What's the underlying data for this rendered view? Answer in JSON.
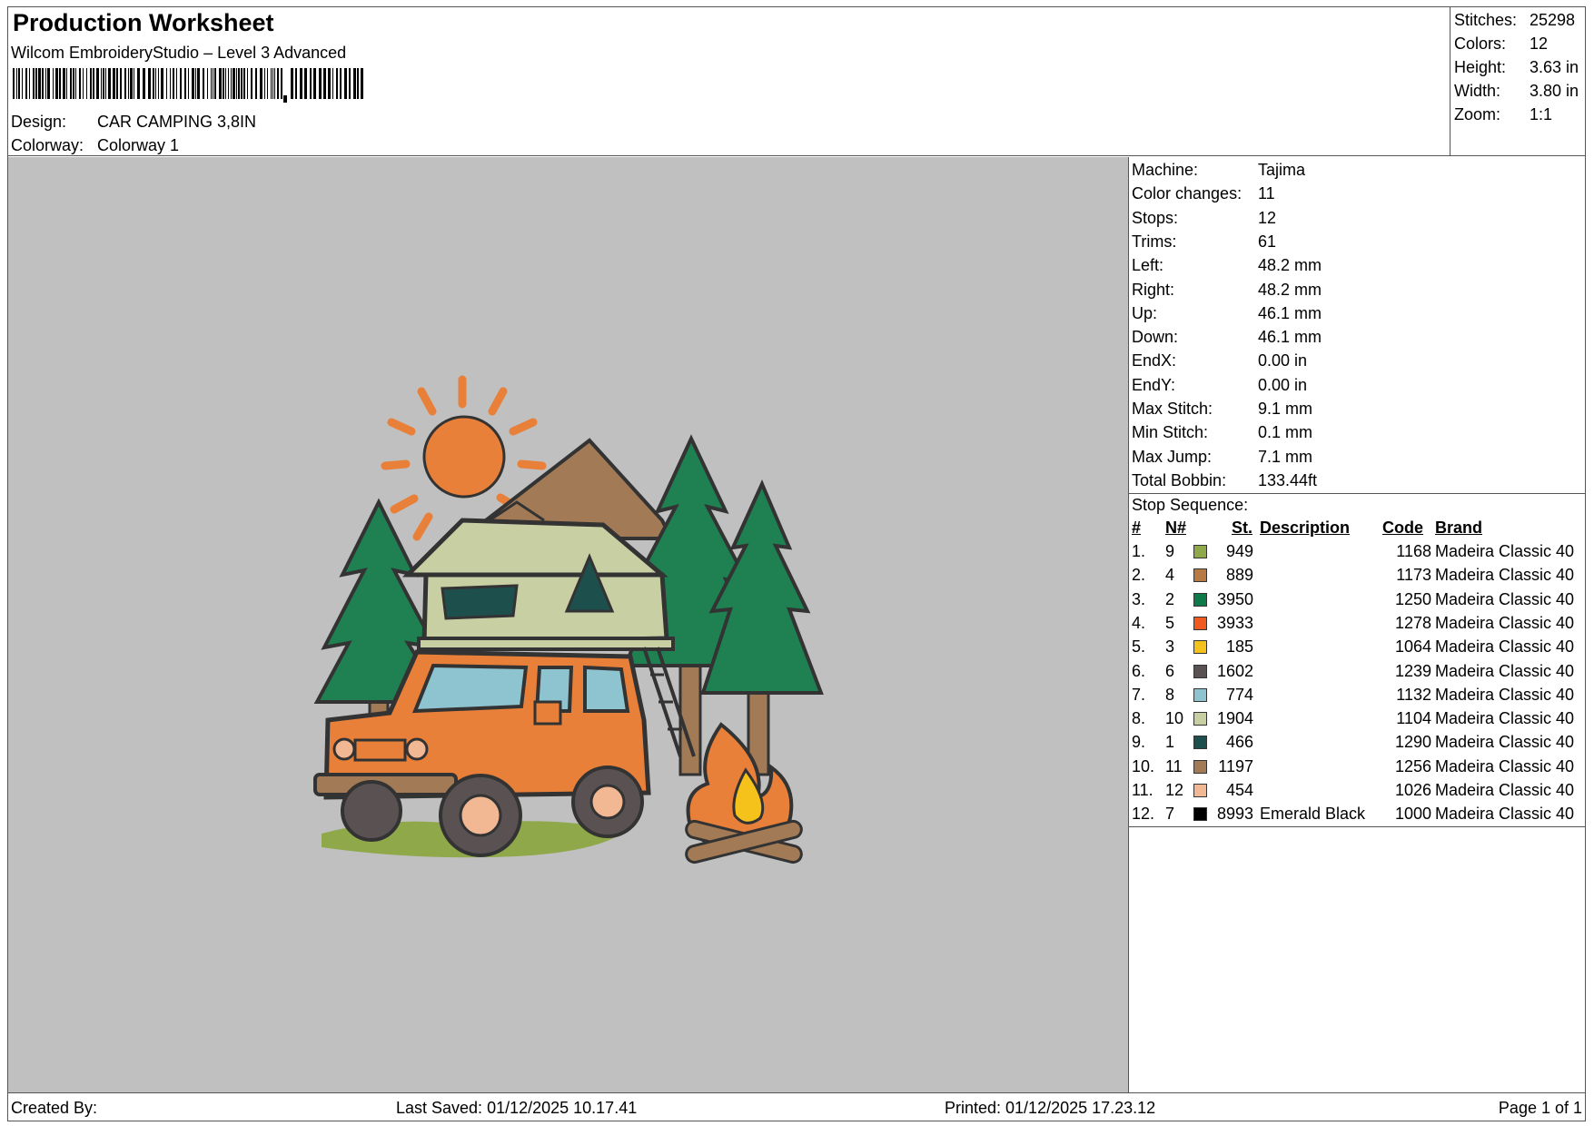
{
  "header": {
    "title": "Production Worksheet",
    "subtitle": "Wilcom EmbroideryStudio – Level 3 Advanced",
    "design_label": "Design:",
    "design_value": "CAR CAMPING 3,8IN",
    "colorway_label": "Colorway:",
    "colorway_value": "Colorway 1"
  },
  "summary": [
    {
      "label": "Stitches:",
      "value": "25298"
    },
    {
      "label": "Colors:",
      "value": "12"
    },
    {
      "label": "Height:",
      "value": "3.63 in"
    },
    {
      "label": "Width:",
      "value": "3.80 in"
    },
    {
      "label": "Zoom:",
      "value": "1:1"
    }
  ],
  "machine_info": [
    {
      "label": "Machine:",
      "value": "Tajima"
    },
    {
      "label": "Color changes:",
      "value": "11"
    },
    {
      "label": "Stops:",
      "value": "12"
    },
    {
      "label": "Trims:",
      "value": "61"
    },
    {
      "label": "Left:",
      "value": "48.2 mm"
    },
    {
      "label": "Right:",
      "value": "48.2 mm"
    },
    {
      "label": "Up:",
      "value": "46.1 mm"
    },
    {
      "label": "Down:",
      "value": "46.1 mm"
    },
    {
      "label": "EndX:",
      "value": "0.00 in"
    },
    {
      "label": "EndY:",
      "value": "0.00 in"
    },
    {
      "label": "Max Stitch:",
      "value": "9.1 mm"
    },
    {
      "label": "Min Stitch:",
      "value": "0.1 mm"
    },
    {
      "label": "Max Jump:",
      "value": "7.1 mm"
    },
    {
      "label": "Total Bobbin:",
      "value": "133.44ft"
    }
  ],
  "stop_sequence": {
    "title": "Stop Sequence:",
    "columns": {
      "num": "#",
      "n": "N#",
      "st": "St.",
      "description": "Description",
      "code": "Code",
      "brand": "Brand"
    },
    "rows": [
      {
        "num": "1.",
        "n": "9",
        "color": "#8fa84a",
        "st": "949",
        "description": "",
        "code": "1168",
        "brand": "Madeira Classic 40"
      },
      {
        "num": "2.",
        "n": "4",
        "color": "#b87a45",
        "st": "889",
        "description": "",
        "code": "1173",
        "brand": "Madeira Classic 40"
      },
      {
        "num": "3.",
        "n": "2",
        "color": "#0e7a4a",
        "st": "3950",
        "description": "",
        "code": "1250",
        "brand": "Madeira Classic 40"
      },
      {
        "num": "4.",
        "n": "5",
        "color": "#f05a1e",
        "st": "3933",
        "description": "",
        "code": "1278",
        "brand": "Madeira Classic 40"
      },
      {
        "num": "5.",
        "n": "3",
        "color": "#f4c21a",
        "st": "185",
        "description": "",
        "code": "1064",
        "brand": "Madeira Classic 40"
      },
      {
        "num": "6.",
        "n": "6",
        "color": "#5a5252",
        "st": "1602",
        "description": "",
        "code": "1239",
        "brand": "Madeira Classic 40"
      },
      {
        "num": "7.",
        "n": "8",
        "color": "#8ec3d0",
        "st": "774",
        "description": "",
        "code": "1132",
        "brand": "Madeira Classic 40"
      },
      {
        "num": "8.",
        "n": "10",
        "color": "#c7cfa3",
        "st": "1904",
        "description": "",
        "code": "1104",
        "brand": "Madeira Classic 40"
      },
      {
        "num": "9.",
        "n": "1",
        "color": "#1d4f4c",
        "st": "466",
        "description": "",
        "code": "1290",
        "brand": "Madeira Classic 40"
      },
      {
        "num": "10.",
        "n": "11",
        "color": "#a27a55",
        "st": "1197",
        "description": "",
        "code": "1256",
        "brand": "Madeira Classic 40"
      },
      {
        "num": "11.",
        "n": "12",
        "color": "#f2b894",
        "st": "454",
        "description": "",
        "code": "1026",
        "brand": "Madeira Classic 40"
      },
      {
        "num": "12.",
        "n": "7",
        "color": "#000000",
        "st": "8993",
        "description": "Emerald Black",
        "code": "1000",
        "brand": "Madeira Classic 40"
      }
    ]
  },
  "footer": {
    "created_by": "Created By:",
    "last_saved": "Last Saved: 01/12/2025 10.17.41",
    "printed": "Printed: 01/12/2025 17.23.12",
    "page": "Page 1 of 1"
  }
}
